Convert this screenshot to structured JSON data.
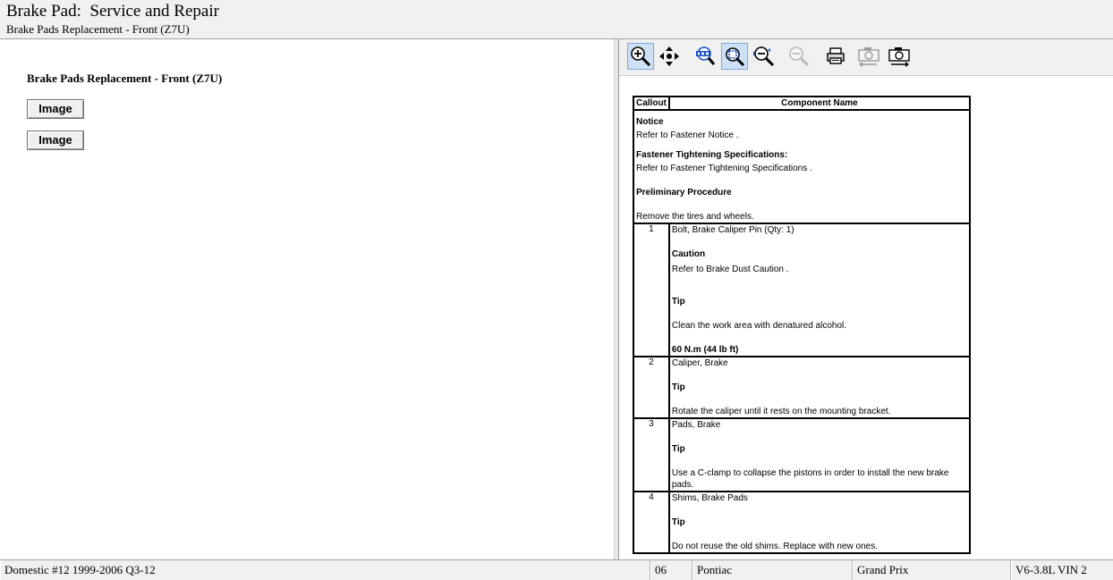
{
  "header": {
    "title": "Brake Pad:  Service and Repair",
    "subtitle": "Brake Pads Replacement - Front (Z7U)"
  },
  "left_pane": {
    "heading": "Brake Pads Replacement - Front (Z7U)",
    "buttons": [
      "Image",
      "Image"
    ]
  },
  "toolbar": {
    "icons": [
      "zoom-in-icon",
      "pan-icon",
      "zoom-100-icon",
      "zoom-fit-icon",
      "zoom-out-icon",
      "zoom-out-disabled-icon",
      "print-icon",
      "camera-previous-icon",
      "camera-next-icon"
    ]
  },
  "table": {
    "headers": [
      "Callout",
      "Component Name"
    ],
    "intro": {
      "notice_title": "Notice",
      "notice_text": "Refer to Fastener Notice .",
      "spec_title": "Fastener Tightening Specifications:",
      "spec_text": "Refer to Fastener Tightening Specifications .",
      "prelim_title": "Preliminary Procedure",
      "prelim_text": "Remove the tires and wheels."
    },
    "rows": [
      {
        "callout": "1",
        "name": "Bolt, Brake Caliper Pin (Qty: 1)",
        "caution_title": "Caution",
        "caution_text": "Refer to Brake Dust Caution .",
        "tip_title": "Tip",
        "tip_text": "Clean the work area with denatured alcohol.",
        "torque": "60 N.m (44 lb ft)"
      },
      {
        "callout": "2",
        "name": "Caliper, Brake",
        "tip_title": "Tip",
        "tip_text": "Rotate the caliper until it rests on the mounting bracket."
      },
      {
        "callout": "3",
        "name": "Pads, Brake",
        "tip_title": "Tip",
        "tip_text": "Use a C-clamp to collapse the pistons in order to install the new brake pads."
      },
      {
        "callout": "4",
        "name": "Shims, Brake Pads",
        "tip_title": "Tip",
        "tip_text": "Do not reuse the old shims. Replace with new ones."
      }
    ]
  },
  "status_bar": {
    "database": "Domestic #12 1999-2006 Q3-12",
    "year": "06",
    "make": "Pontiac",
    "model": "Grand Prix",
    "engine": "V6-3.8L VIN 2"
  },
  "colors": {
    "chrome": "#f0f0f0",
    "active_tool": "#cde0f5",
    "tool_blue": "#1a4fc4"
  }
}
